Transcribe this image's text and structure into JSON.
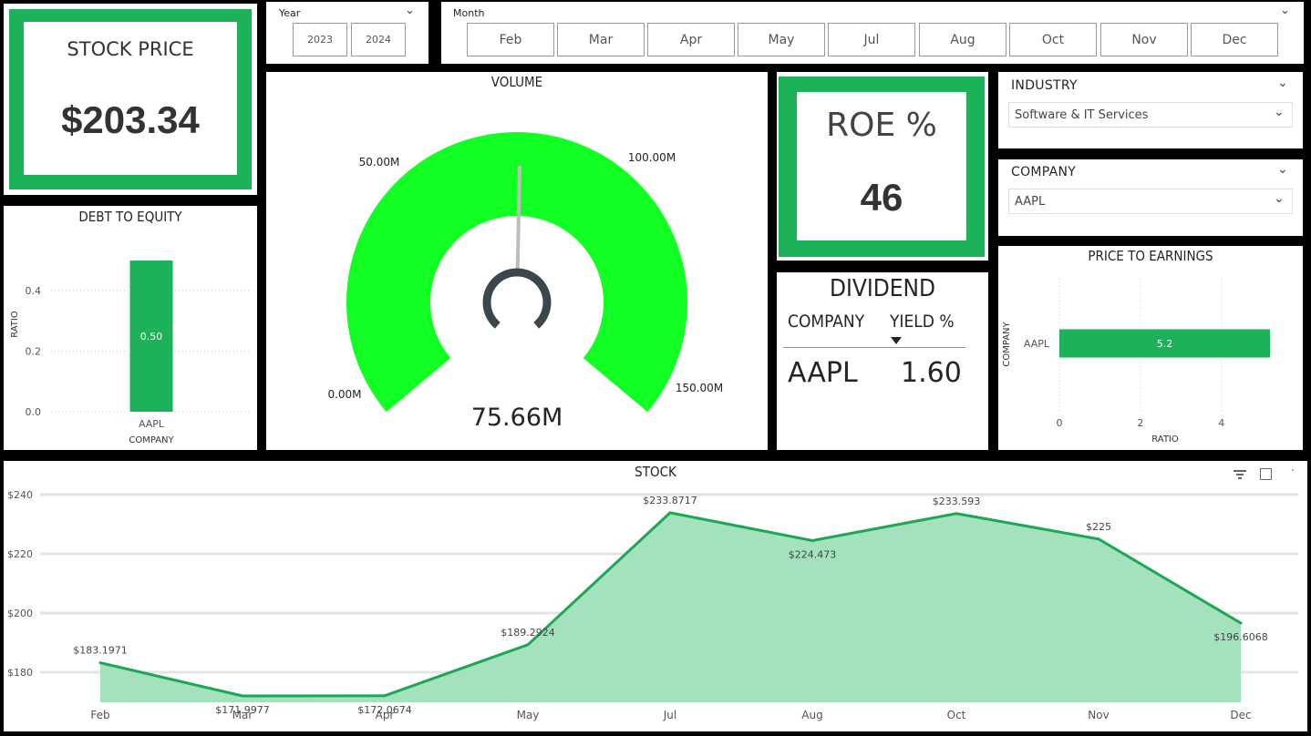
{
  "stock_price_card": {
    "title": "STOCK PRICE",
    "value": "$203.34"
  },
  "year_slicer": {
    "label": "Year",
    "options": [
      "2023",
      "2024"
    ]
  },
  "month_slicer": {
    "label": "Month",
    "options": [
      "Feb",
      "Mar",
      "Apr",
      "May",
      "Jul",
      "Aug",
      "Oct",
      "Nov",
      "Dec"
    ]
  },
  "volume_gauge": {
    "title": "VOLUME",
    "value": 75.66,
    "value_label": "75.66M",
    "min": 0,
    "max": 150,
    "target": 100,
    "min_label": "0.00M",
    "max_label": "150.00M",
    "target_label": "100.00M",
    "mid_label": "50.00M",
    "color": "#12ff23"
  },
  "roe_card": {
    "title": "ROE %",
    "value": "46"
  },
  "industry_slicer": {
    "title": "INDUSTRY",
    "selected": "Software & IT Services"
  },
  "company_slicer": {
    "title": "COMPANY",
    "selected": "AAPL"
  },
  "dividend_table": {
    "title": "DIVIDEND",
    "columns": [
      "COMPANY",
      "YIELD %"
    ],
    "rows": [
      [
        "AAPL",
        "1.60"
      ]
    ]
  },
  "chart_data": [
    {
      "type": "bar",
      "title": "DEBT TO EQUITY",
      "xlabel": "COMPANY",
      "ylabel": "RATIO",
      "categories": [
        "AAPL"
      ],
      "values": [
        0.5
      ],
      "data_labels": [
        "0.50"
      ],
      "yticks": [
        "0.0",
        "0.2",
        "0.4"
      ],
      "ylim": [
        0,
        0.5
      ],
      "color": "#1db15a",
      "grid": true
    },
    {
      "type": "bar",
      "orientation": "horizontal",
      "title": "PRICE TO EARNINGS",
      "xlabel": "RATIO",
      "ylabel": "COMPANY",
      "categories": [
        "AAPL"
      ],
      "values": [
        5.2
      ],
      "data_labels": [
        "5.2"
      ],
      "xticks": [
        "0",
        "2",
        "4"
      ],
      "xlim": [
        0,
        5.2
      ],
      "color": "#1db15a",
      "grid": true
    },
    {
      "type": "area",
      "title": "STOCK",
      "categories": [
        "Feb",
        "Mar",
        "Apr",
        "May",
        "Jul",
        "Aug",
        "Oct",
        "Nov",
        "Dec"
      ],
      "values": [
        183.1971,
        171.9977,
        172.0674,
        189.2924,
        233.8717,
        224.473,
        233.593,
        225,
        196.6068
      ],
      "data_labels": [
        "$183.1971",
        "$171.9977",
        "$172.0674",
        "$189.2924",
        "$233.8717",
        "$224.473",
        "$233.593",
        "$225",
        "$196.6068"
      ],
      "yticks": [
        "$180",
        "$200",
        "$220",
        "$240"
      ],
      "ylim": [
        170,
        240
      ],
      "line_color": "#1da653",
      "fill_color": "#a3e2bc",
      "grid": true
    }
  ]
}
